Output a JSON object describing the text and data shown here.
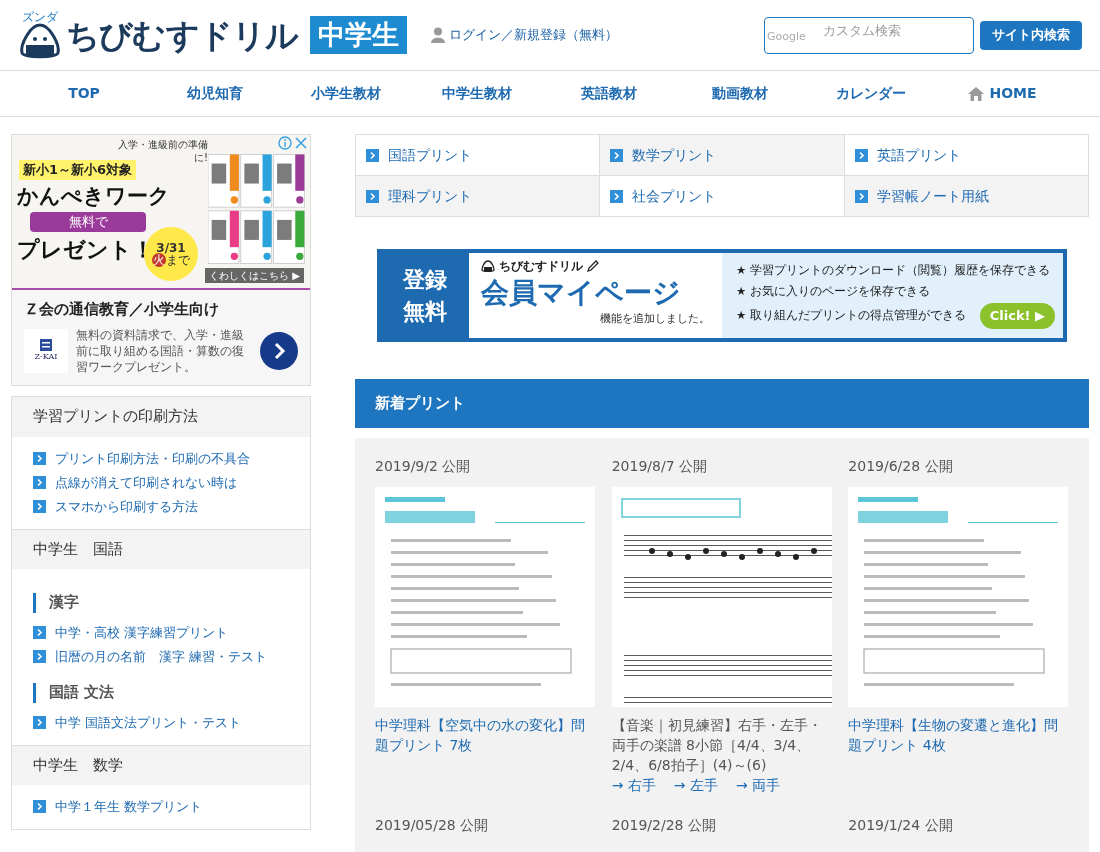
{
  "header": {
    "logo_tag": "ズンダ",
    "logo_text": "ちびむすドリル",
    "logo_badge": "中学生",
    "login": "ログイン／新規登録（無料）",
    "search": {
      "brand": "Google",
      "placeholder": "カスタム検索"
    },
    "search_button": "サイト内検索"
  },
  "nav": [
    {
      "label": "TOP",
      "kind": "text"
    },
    {
      "label": "幼児知育",
      "kind": "text"
    },
    {
      "label": "小学生教材",
      "kind": "text"
    },
    {
      "label": "中学生教材",
      "kind": "text"
    },
    {
      "label": "英語教材",
      "kind": "text"
    },
    {
      "label": "動画教材",
      "kind": "text"
    },
    {
      "label": "カレンダー",
      "kind": "text"
    },
    {
      "label": "HOME",
      "kind": "home"
    }
  ],
  "ad": {
    "target": "新小1～新小6対象",
    "title": "かんぺきワーク",
    "free": "無料で",
    "present": "プレゼント！",
    "deadline": "3/31",
    "deadline_day": "火",
    "deadline_suffix": "まで",
    "note": "入学・進級前の準備に!",
    "more": "くわしくはこちら ▶",
    "heading": "Ｚ会の通信教育／小学生向け",
    "logo": "Z-KAI",
    "body": "無料の資料請求で、入学・進級前に取り組める国語・算数の復習ワークプレゼント。"
  },
  "sidebar": [
    {
      "title": "学習プリントの印刷方法",
      "groups": [
        {
          "links": [
            "プリント印刷方法・印刷の不具合",
            "点線が消えて印刷されない時は",
            "スマホから印刷する方法"
          ]
        }
      ]
    },
    {
      "title": "中学生　国語",
      "groups": [
        {
          "heading": "漢字",
          "links": [
            "中学・高校 漢字練習プリント",
            "旧暦の月の名前　漢字 練習・テスト"
          ]
        },
        {
          "heading": "国語 文法",
          "links": [
            "中学 国語文法プリント・テスト"
          ]
        }
      ]
    },
    {
      "title": "中学生　数学",
      "groups": [
        {
          "links": [
            "中学１年生 数学プリント"
          ]
        }
      ]
    }
  ],
  "subjects": [
    "国語プリント",
    "数学プリント",
    "英語プリント",
    "理科プリント",
    "社会プリント",
    "学習帳ノート用紙"
  ],
  "member_banner": {
    "left": "登録無料",
    "brand": "ちびむすドリル",
    "title": "会員マイページ",
    "subtitle": "機能を追加しました。",
    "features": [
      "★ 学習プリントのダウンロード（閲覧）履歴を保存できる",
      "★ お気に入りのページを保存できる",
      "★ 取り組んだプリントの得点管理ができる"
    ],
    "button": "Click! ▶"
  },
  "new_prints": {
    "title": "新着プリント",
    "items": [
      {
        "date": "2019/9/2 公開",
        "kind": "science",
        "title": "中学理科【空気中の水の変化】問題プリント 7枚"
      },
      {
        "date": "2019/8/7 公開",
        "kind": "music",
        "title": "【音楽｜初見練習】右手・左手・両手の楽譜 8小節［4/4、3/4、2/4、6/8拍子］(4)～(6)",
        "links": [
          "→ 右手",
          "→ 左手",
          "→ 両手"
        ]
      },
      {
        "date": "2019/6/28 公開",
        "kind": "science",
        "title": "中学理科【生物の変遷と進化】問題プリント 4枚"
      },
      {
        "date": "2019/05/28 公開"
      },
      {
        "date": "2019/2/28 公開"
      },
      {
        "date": "2019/1/24 公開"
      }
    ]
  }
}
